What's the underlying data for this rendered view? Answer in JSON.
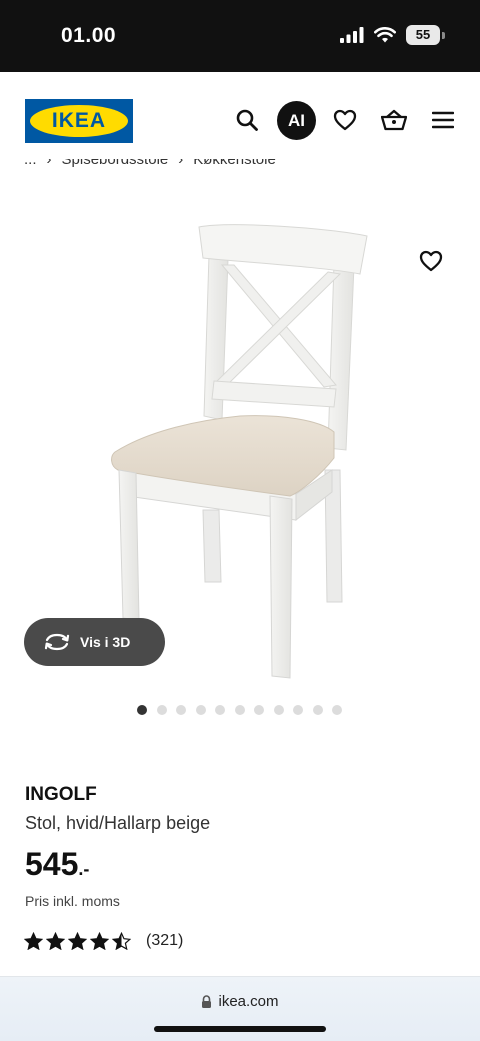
{
  "status_bar": {
    "time": "01.00",
    "battery": "55"
  },
  "header": {
    "logo_text": "IKEA",
    "ai_label": "AI",
    "icons": [
      "search-icon",
      "heart-icon",
      "basket-icon",
      "menu-icon"
    ]
  },
  "breadcrumb": {
    "items": [
      "...",
      "Spisebordsstole",
      "Køkkenstole"
    ]
  },
  "product": {
    "view3d_label": "Vis i 3D",
    "image_count": 11,
    "active_image": 1,
    "name": "INGOLF",
    "description": "Stol, hvid/Hallarp beige",
    "price": "545",
    "price_suffix": ".-",
    "price_note": "Pris inkl. moms",
    "rating": 4.5,
    "rating_max": 5,
    "review_count": "(321)"
  },
  "browser": {
    "url": "ikea.com"
  },
  "colors": {
    "ikea_blue": "#0058a3",
    "ikea_yellow": "#ffdb00",
    "dark": "#111111"
  }
}
